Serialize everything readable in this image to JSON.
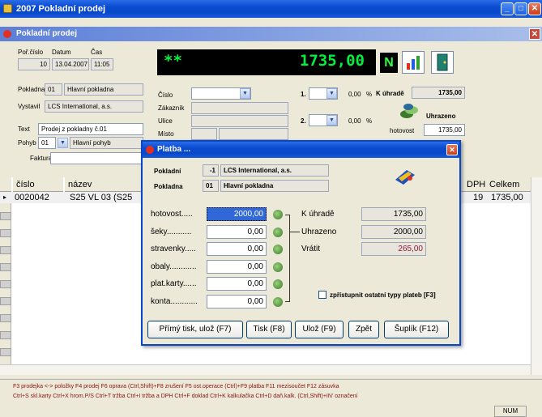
{
  "window": {
    "title": "2007 Pokladní prodej"
  },
  "sub": {
    "title": "Pokladní prodej"
  },
  "header": {
    "por_cislo_label": "Poř.číslo",
    "por_cislo": "10",
    "datum_label": "Datum",
    "datum": "13.04.2007",
    "cas_label": "Čas",
    "cas": "11:05",
    "pokladna_label": "Pokladna",
    "pokladna_code": "01",
    "pokladna_name": "Hlavní pokladna",
    "vystavil_label": "Vystavil",
    "vystavil": "LCS International, a.s.",
    "text_label": "Text",
    "text": "Prodej z pokladny č.01",
    "pohyb_label": "Pohyb",
    "pohyb_code": "01",
    "pohyb_name": "Hlavní pohyb",
    "faktura_label": "Faktura"
  },
  "customer": {
    "cislo_label": "Číslo",
    "zakaznik_label": "Zákazník",
    "ulice_label": "Ulice",
    "misto_label": "Místo"
  },
  "discount": {
    "row1_label": "1.",
    "row1_value": "0,00",
    "row2_label": "2.",
    "row2_value": "0,00",
    "percent": "%"
  },
  "lcd": {
    "stars": "**",
    "total": "1735,00",
    "mode": "N"
  },
  "summary": {
    "k_uhrade_label": "K úhradě",
    "k_uhrade": "1735,00",
    "uhrazeno_label": "Uhrazeno",
    "hotovost_label": "hotovost",
    "hotovost": "1735,00"
  },
  "grid": {
    "columns": [
      "číslo",
      "název",
      "DPH",
      "Celkem"
    ],
    "rows": [
      {
        "cislo": "0020042",
        "nazev": "S25 VL 03 (S25",
        "dph": "19",
        "celkem": "1735,00"
      }
    ]
  },
  "status": {
    "line1": "F3 prodejka <-> položky  F4 prodej F6 oprava  (Ctrl,Shift)+F8 zrušení  F5 ost.operace  (Ctrl)+F9 platba  F11 mezisoučet  F12 zásuvka",
    "line2": "Ctrl+S skl.karty Ctrl+X hrom.P/S Ctrl+T tržba Ctrl+I tržba a DPH Ctrl+F doklad  Ctrl+K kalkulačka Ctrl+D daň.kalk. (Ctrl,Shift)+IN' označení",
    "num": "NUM"
  },
  "dialog": {
    "title": "Platba ...",
    "pokladni_label": "Pokladní",
    "pokladni_code": "-1",
    "pokladni_name": "LCS International, a.s.",
    "pokladna_label": "Pokladna",
    "pokladna_code": "01",
    "pokladna_name": "Hlavní pokladna",
    "payments": [
      {
        "label": "hotovost.....",
        "value": "2000,00"
      },
      {
        "label": "šeky...........",
        "value": "0,00"
      },
      {
        "label": "stravenky.....",
        "value": "0,00"
      },
      {
        "label": "obaly............",
        "value": "0,00"
      },
      {
        "label": "plat.karty......",
        "value": "0,00"
      },
      {
        "label": "konta............",
        "value": "0,00"
      }
    ],
    "k_uhrade_label": "K úhradě",
    "k_uhrade": "1735,00",
    "uhrazeno_label": "Uhrazeno",
    "uhrazeno": "2000,00",
    "vratit_label": "Vrátit",
    "vratit": "265,00",
    "checkbox_label": "zpřístupnit ostatní typy plateb [F3]",
    "buttons": {
      "print": "Přímý tisk, ulož (F7)",
      "tisk": "Tisk (F8)",
      "uloz": "Ulož (F9)",
      "zpet": "Zpět",
      "suplik": "Šuplík (F12)"
    }
  },
  "colors": {
    "title_blue": "#0848C8",
    "lcd_green": "#00F040",
    "vratit": "#8B1A3A",
    "status_text": "#8B1010"
  }
}
